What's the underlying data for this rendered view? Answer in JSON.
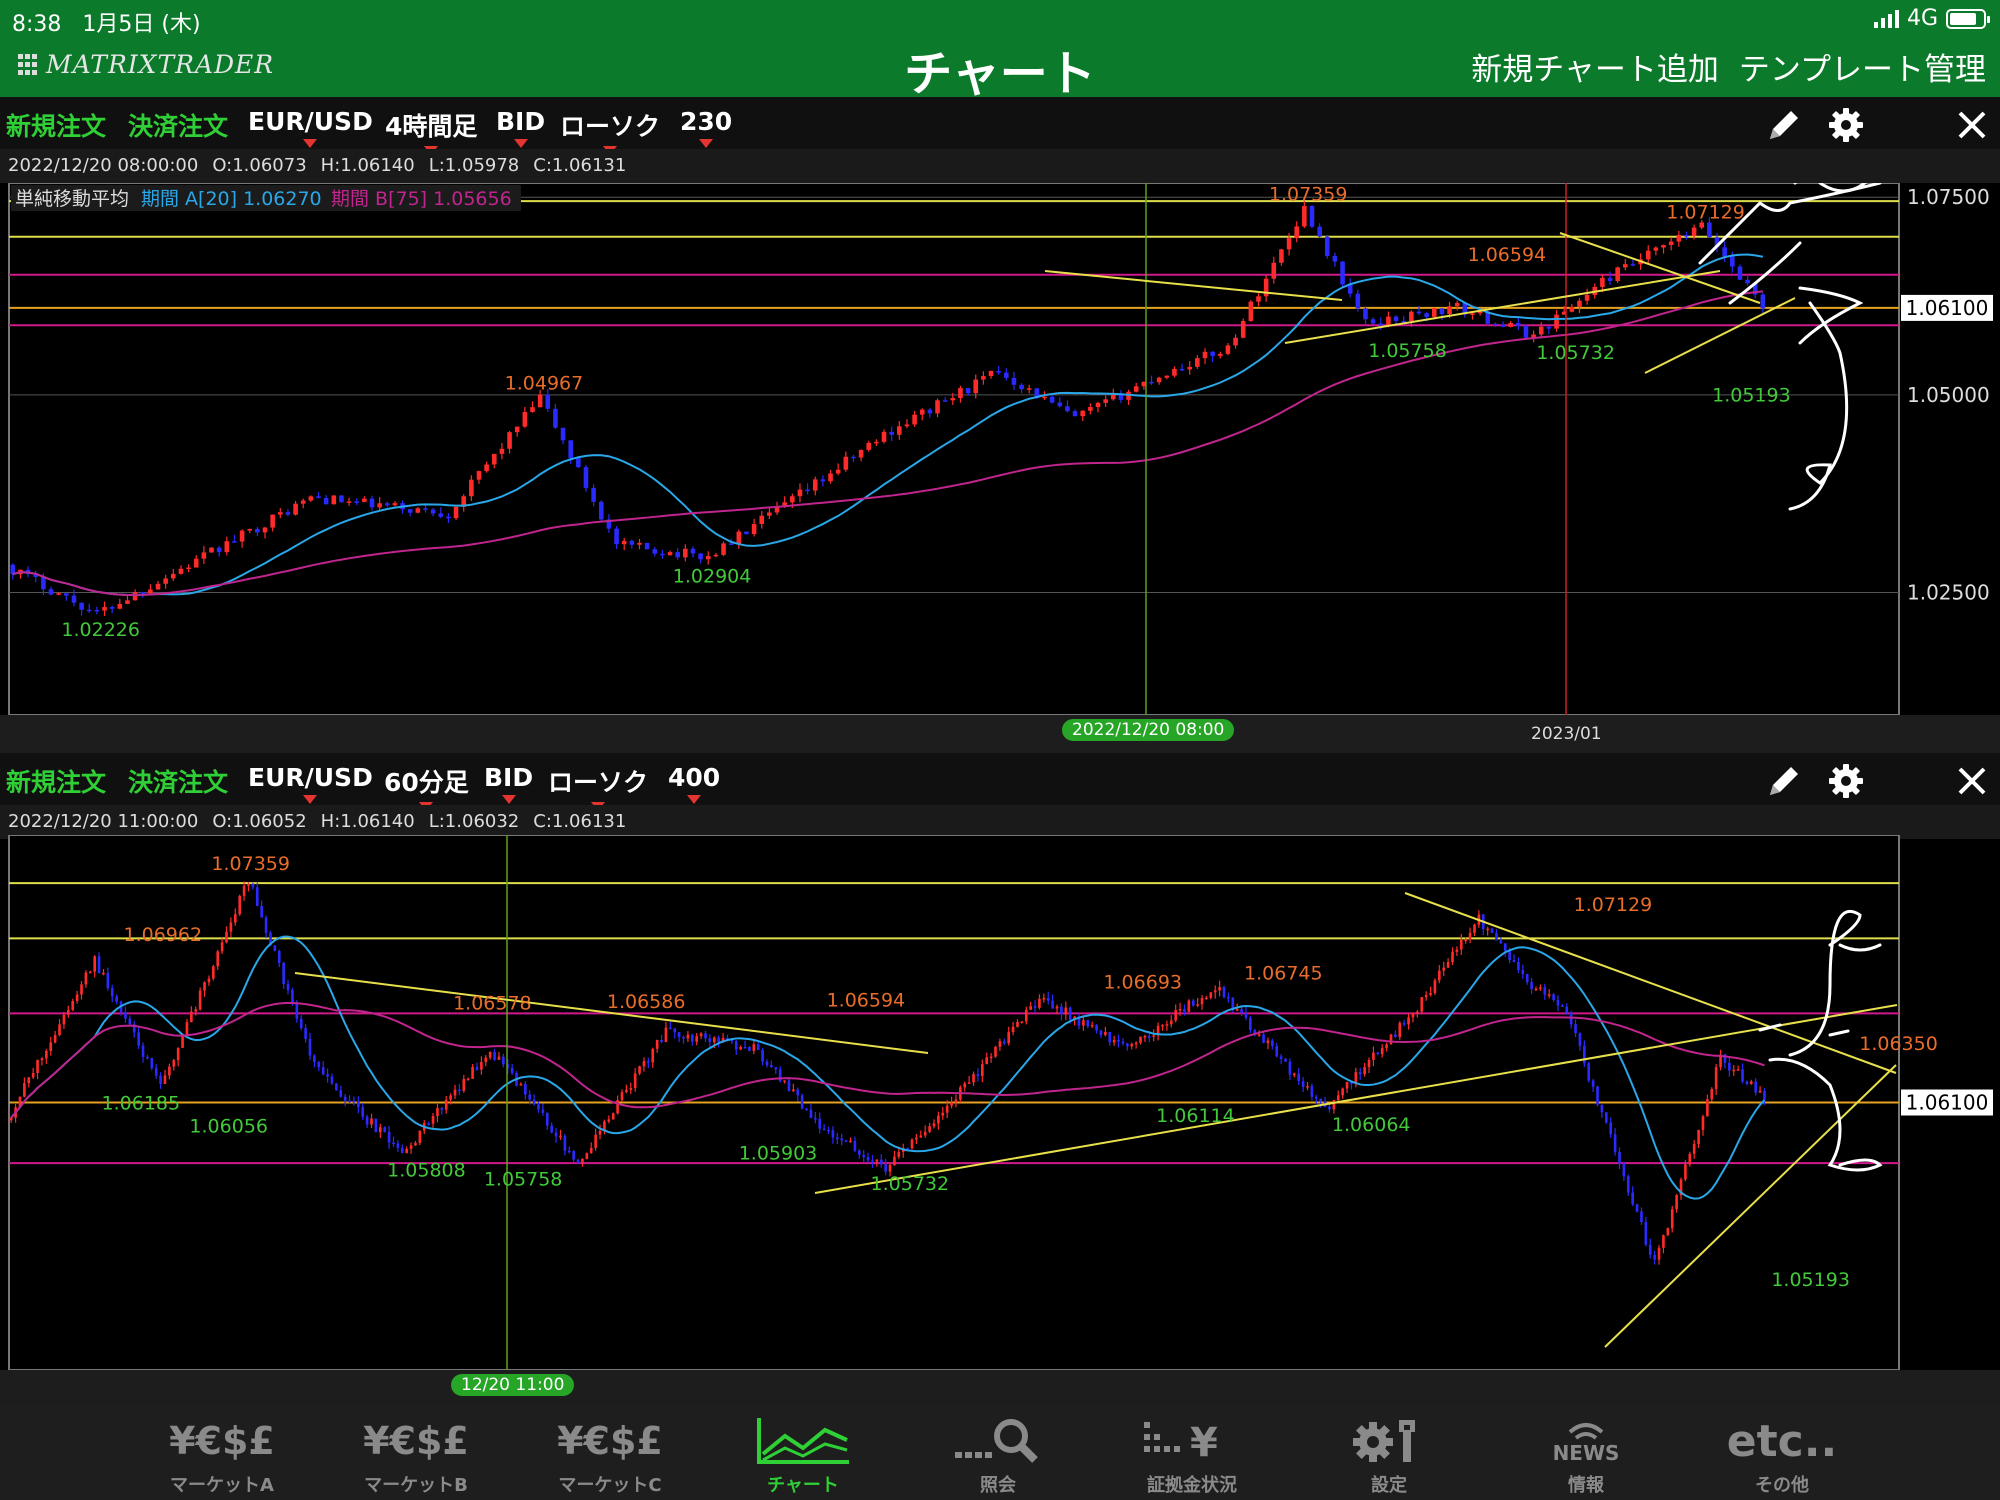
{
  "status_bar": {
    "time": "8:38",
    "date": "1月5日 (木)",
    "network": "4G"
  },
  "header": {
    "logo": "MATRIXTRADER",
    "title": "チャート",
    "actions": [
      "新規チャート追加",
      "テンプレート管理"
    ]
  },
  "colors": {
    "header_green": "#0b7a2a",
    "order_green": "#2fcf36",
    "bull": "#ff2a2a",
    "bear": "#2a2aff",
    "ma_a": "#29a7e8",
    "ma_b": "#c0258e",
    "trend": "#e7e04a",
    "hline_orange": "#e4a21f",
    "hline_yellow": "#dede4b",
    "hline_magenta": "#d01a8c",
    "hi_label": "#e86d2a",
    "lo_label": "#42c93a"
  },
  "chart_top": {
    "toolbar": {
      "new_order": "新規注文",
      "close_order": "決済注文",
      "symbol": "EUR/USD",
      "timeframe": "4時間足",
      "price_side": "BID",
      "chart_type": "ローソク",
      "count": "230"
    },
    "ohlc": {
      "datetime": "2022/12/20 08:00:00",
      "open": "O:1.06073",
      "high": "H:1.06140",
      "low": "L:1.05978",
      "close": "C:1.06131"
    },
    "legend": {
      "title": "単純移動平均",
      "a": "期間 A[20] 1.06270",
      "b": "期間 B[75] 1.05656"
    },
    "cursor_label": "2022/12/20 08:00",
    "date_label": "2023/01",
    "current_price": "1.06100",
    "y_ticks": [
      "1.07500",
      "1.05000",
      "1.02500"
    ]
  },
  "chart_bottom": {
    "toolbar": {
      "new_order": "新規注文",
      "close_order": "決済注文",
      "symbol": "EUR/USD",
      "timeframe": "60分足",
      "price_side": "BID",
      "chart_type": "ローソク",
      "count": "400"
    },
    "ohlc": {
      "datetime": "2022/12/20 11:00:00",
      "open": "O:1.06052",
      "high": "H:1.06140",
      "low": "L:1.06032",
      "close": "C:1.06131"
    },
    "cursor_label": "12/20 11:00",
    "current_price": "1.06100"
  },
  "chart_data": [
    {
      "type": "line",
      "title": "EUR/USD 4時間足",
      "ylim": [
        1.0095,
        1.0768
      ],
      "series": [
        {
          "x": [
            0,
            12,
            25,
            40,
            58,
            70,
            80,
            92,
            105,
            115,
            130,
            140,
            150,
            160,
            170,
            178,
            190,
            200,
            210,
            222,
            230
          ],
          "values": [
            1.0285,
            1.0223,
            1.029,
            1.037,
            1.035,
            1.0497,
            1.031,
            1.0295,
            1.038,
            1.045,
            1.053,
            1.047,
            1.052,
            1.056,
            1.0736,
            1.059,
            1.061,
            1.0575,
            1.065,
            1.0713,
            1.0613
          ]
        }
      ],
      "annotations": [
        {
          "label": "1.02226",
          "x": 12,
          "kind": "low"
        },
        {
          "label": "1.04967",
          "x": 70,
          "kind": "high"
        },
        {
          "label": "1.02904",
          "x": 92,
          "kind": "low"
        },
        {
          "label": "1.07359",
          "x": 170,
          "kind": "high"
        },
        {
          "label": "1.05758",
          "x": 183,
          "kind": "low"
        },
        {
          "label": "1.06594",
          "x": 196,
          "kind": "high"
        },
        {
          "label": "1.05732",
          "x": 205,
          "kind": "low"
        },
        {
          "label": "1.07129",
          "x": 222,
          "kind": "high"
        },
        {
          "label": "1.05193",
          "x": 228,
          "kind": "low"
        }
      ],
      "hlines": [
        1.0745,
        1.07,
        1.0652,
        1.061,
        1.0588
      ]
    },
    {
      "type": "line",
      "title": "EUR/USD 60分足",
      "ylim": [
        1.046,
        1.076
      ],
      "series": [
        {
          "x": [
            0,
            20,
            35,
            55,
            70,
            90,
            110,
            130,
            150,
            170,
            185,
            200,
            215,
            235,
            255,
            275,
            300,
            320,
            335,
            345,
            355,
            375,
            390,
            400
          ],
          "values": [
            1.06,
            1.069,
            1.0618,
            1.0735,
            1.063,
            1.0581,
            1.064,
            1.0576,
            1.065,
            1.064,
            1.0598,
            1.0573,
            1.061,
            1.0669,
            1.064,
            1.0675,
            1.0606,
            1.066,
            1.0713,
            1.068,
            1.066,
            1.0519,
            1.0635,
            1.0613
          ]
        }
      ],
      "annotations": [
        {
          "label": "1.07359",
          "x": 55,
          "kind": "high"
        },
        {
          "label": "1.06962",
          "x": 35,
          "kind": "high"
        },
        {
          "label": "1.06185",
          "x": 30,
          "kind": "low"
        },
        {
          "label": "1.06056",
          "x": 50,
          "kind": "low"
        },
        {
          "label": "1.06578",
          "x": 110,
          "kind": "high"
        },
        {
          "label": "1.06586",
          "x": 145,
          "kind": "high"
        },
        {
          "label": "1.05808",
          "x": 95,
          "kind": "low"
        },
        {
          "label": "1.05758",
          "x": 117,
          "kind": "low"
        },
        {
          "label": "1.06594",
          "x": 195,
          "kind": "high"
        },
        {
          "label": "1.05903",
          "x": 175,
          "kind": "low"
        },
        {
          "label": "1.05732",
          "x": 205,
          "kind": "low"
        },
        {
          "label": "1.06693",
          "x": 258,
          "kind": "high"
        },
        {
          "label": "1.06745",
          "x": 290,
          "kind": "high"
        },
        {
          "label": "1.06114",
          "x": 270,
          "kind": "low"
        },
        {
          "label": "1.06064",
          "x": 310,
          "kind": "low"
        },
        {
          "label": "1.07129",
          "x": 365,
          "kind": "high"
        },
        {
          "label": "1.06350",
          "x": 430,
          "kind": "high"
        },
        {
          "label": "1.05193",
          "x": 410,
          "kind": "low"
        }
      ],
      "hlines": [
        1.0733,
        1.0702,
        1.066,
        1.061,
        1.0576
      ]
    }
  ],
  "tabbar": {
    "items": [
      {
        "icon": "¥€$£",
        "label": "マーケットA",
        "active": false
      },
      {
        "icon": "¥€$£",
        "label": "マーケットB",
        "active": false
      },
      {
        "icon": "¥€$£",
        "label": "マーケットC",
        "active": false
      },
      {
        "icon": "chart-line-icon",
        "label": "チャート",
        "active": true
      },
      {
        "icon": "search-icon",
        "label": "照会",
        "active": false
      },
      {
        "icon": "margin-icon",
        "label": "証拠金状況",
        "active": false
      },
      {
        "icon": "gear-icon",
        "label": "設定",
        "active": false
      },
      {
        "icon": "news-icon",
        "label": "情報",
        "active": false
      },
      {
        "icon": "etc..",
        "label": "その他",
        "active": false
      }
    ]
  }
}
